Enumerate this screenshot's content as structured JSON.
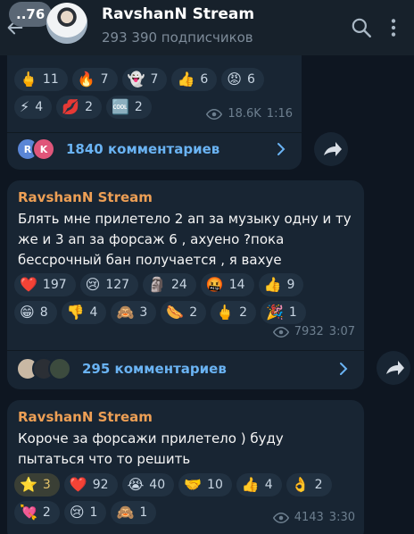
{
  "header": {
    "unread_count": "..76",
    "channel_name": "RavshanN Stream",
    "subscribers": "293 390 подписчиков"
  },
  "posts": [
    {
      "reactions": [
        {
          "emoji": "🖕",
          "count": "11"
        },
        {
          "emoji": "🔥",
          "count": "7"
        },
        {
          "emoji": "👻",
          "count": "7"
        },
        {
          "emoji": "👍",
          "count": "6"
        },
        {
          "emoji": "😡",
          "count": "6"
        },
        {
          "emoji": "⚡",
          "count": "4"
        },
        {
          "emoji": "💋",
          "count": "2"
        },
        {
          "emoji": "🆒",
          "count": "2"
        }
      ],
      "views": "18.6K",
      "time": "1:16",
      "comments_label": "1840 комментариев",
      "commenters": [
        "R",
        "K"
      ]
    },
    {
      "author": "RavshanN Stream",
      "text": "Блять мне прилетело 2 ап за музыку одну и ту же и 3 ап за форсаж 6 , ахуено ?пока бессрочный бан получается , я вахуе",
      "reactions": [
        {
          "emoji": "❤️",
          "count": "197"
        },
        {
          "emoji": "😢",
          "count": "127"
        },
        {
          "emoji": "🗿",
          "count": "24"
        },
        {
          "emoji": "🤬",
          "count": "14"
        },
        {
          "emoji": "👍",
          "count": "9"
        },
        {
          "emoji": "😁",
          "count": "8"
        },
        {
          "emoji": "👎",
          "count": "4"
        },
        {
          "emoji": "🙈",
          "count": "3"
        },
        {
          "emoji": "🌭",
          "count": "2"
        },
        {
          "emoji": "🖕",
          "count": "2"
        },
        {
          "emoji": "🎉",
          "count": "1"
        }
      ],
      "views": "7932",
      "time": "3:07",
      "comments_label": "295 комментариев"
    },
    {
      "author": "RavshanN Stream",
      "text": "Короче за форсажи прилетело ) буду пытаться что то решить",
      "reactions": [
        {
          "emoji": "⭐",
          "count": "3",
          "mine": true
        },
        {
          "emoji": "❤️",
          "count": "92"
        },
        {
          "emoji": "😭",
          "count": "40"
        },
        {
          "emoji": "🤝",
          "count": "10"
        },
        {
          "emoji": "👍",
          "count": "4"
        },
        {
          "emoji": "👌",
          "count": "2"
        },
        {
          "emoji": "💘",
          "count": "2"
        },
        {
          "emoji": "😢",
          "count": "1"
        },
        {
          "emoji": "🙈",
          "count": "1"
        }
      ],
      "views": "4143",
      "time": "3:30"
    }
  ],
  "icons": {
    "back": "arrow-left-icon",
    "search": "search-icon",
    "menu": "more-vertical-icon",
    "views": "eye-icon",
    "share": "share-arrow-icon",
    "chevron": "chevron-right-icon"
  }
}
